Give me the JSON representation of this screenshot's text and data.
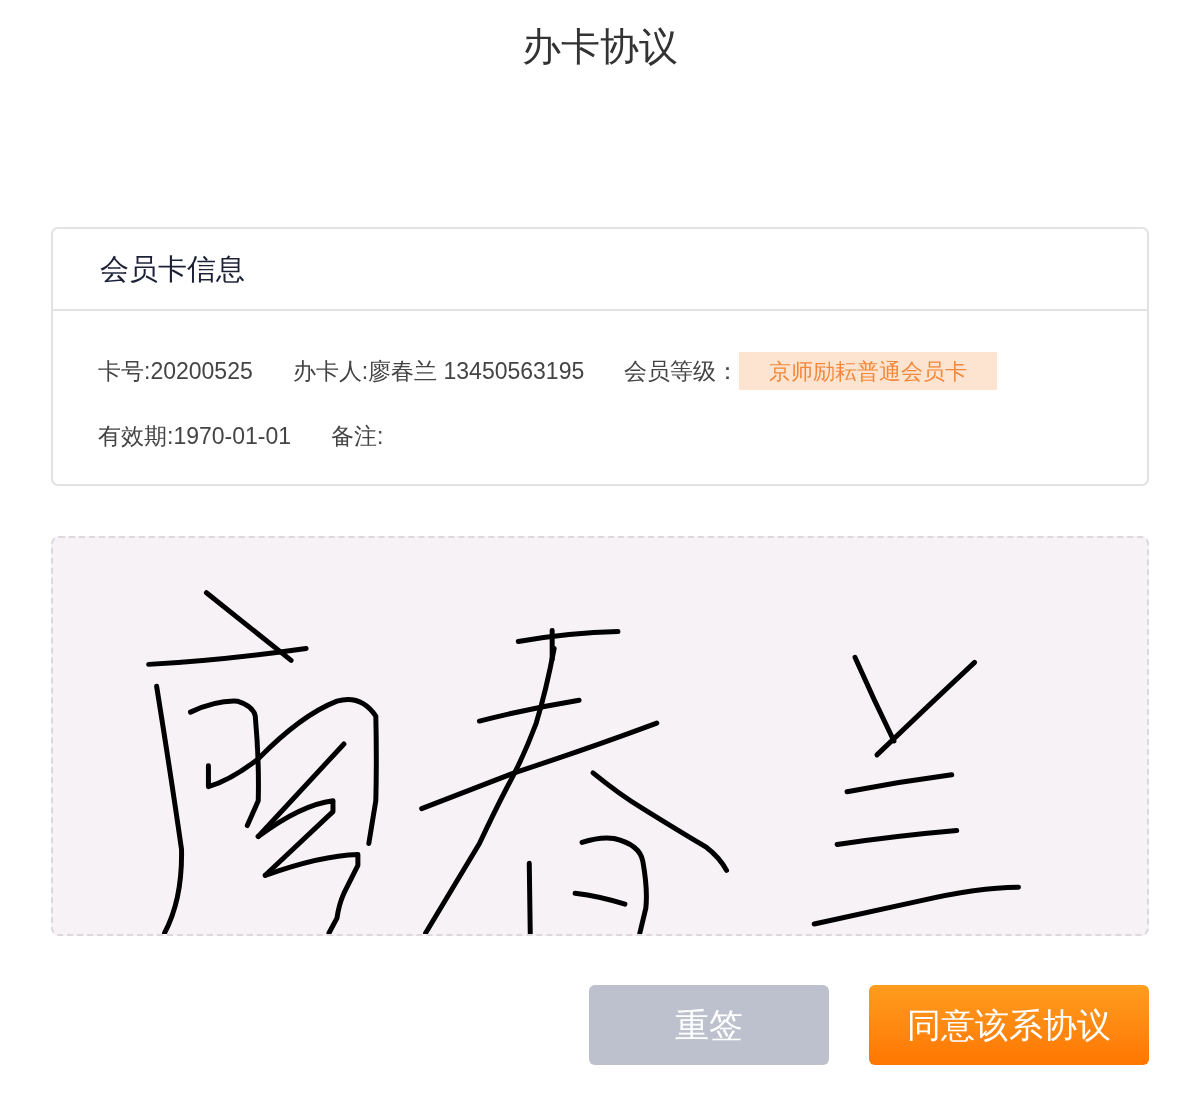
{
  "page": {
    "title": "办卡协议"
  },
  "card": {
    "title": "会员卡信息",
    "rows": [
      [
        {
          "kind": "text",
          "text": "卡号:20200525"
        },
        {
          "kind": "text",
          "text": "办卡人:廖春兰 13450563195"
        },
        {
          "kind": "text",
          "text": "会员等级："
        },
        {
          "kind": "badge",
          "text": "京师励耘普通会员卡"
        }
      ],
      [
        {
          "kind": "text",
          "text": "有效期:1970-01-01"
        },
        {
          "kind": "text",
          "text": "备注:"
        }
      ]
    ]
  },
  "signature": {
    "signed": true
  },
  "buttons": [
    {
      "kind": "secondary",
      "label": "重签"
    },
    {
      "kind": "primary",
      "label": "同意该系协议"
    }
  ]
}
